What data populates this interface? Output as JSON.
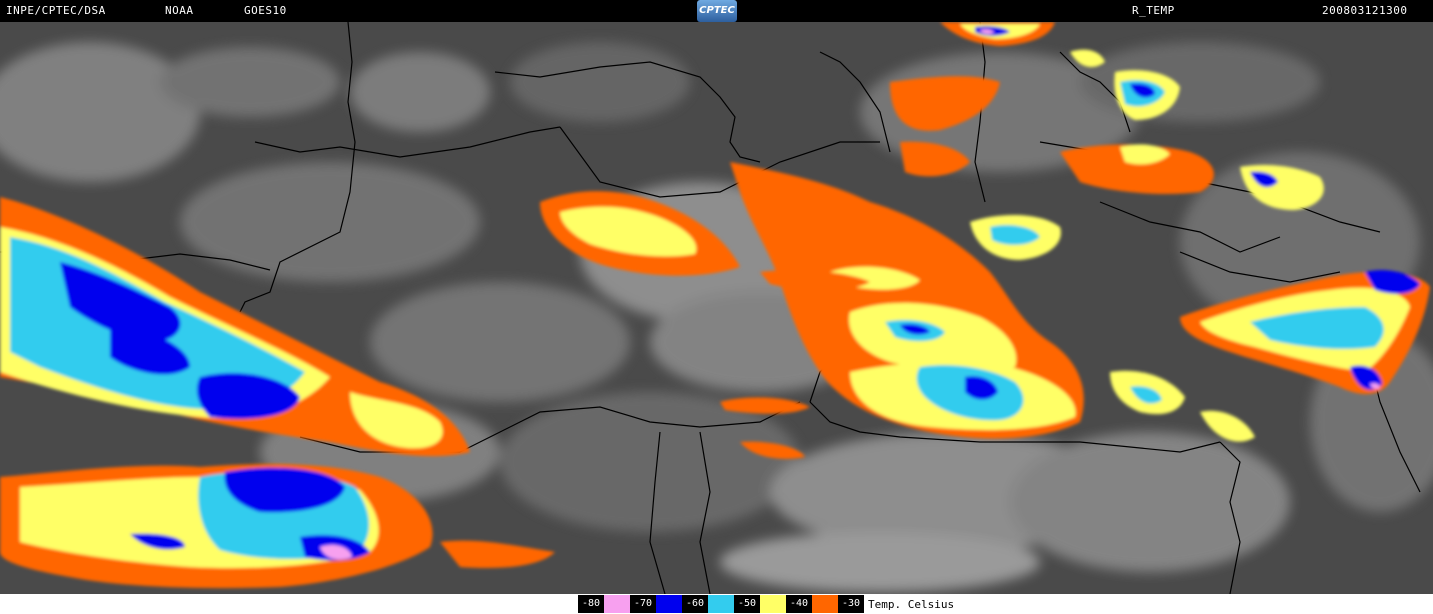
{
  "header": {
    "source": "INPE/CPTEC/DSA",
    "agency": "NOAA",
    "satellite": "GOES10",
    "logo_text": "CPTEC",
    "product": "R_TEMP",
    "datetime": "200803121300"
  },
  "legend": {
    "title": "Temp. Celsius",
    "items": [
      {
        "label": "-80",
        "color": "#f7a0ef"
      },
      {
        "label": "-70",
        "color": "#0000ee"
      },
      {
        "label": "-60",
        "color": "#33ccee"
      },
      {
        "label": "-50",
        "color": "#ffff66"
      },
      {
        "label": "-40",
        "color": "#ff6600"
      },
      {
        "label": "-30",
        "color": null
      }
    ]
  },
  "colors": {
    "ground": "#4a4a4a",
    "cloud": "#b5b5b5",
    "border": "#000000"
  },
  "icons": [
    "cptec-logo"
  ]
}
